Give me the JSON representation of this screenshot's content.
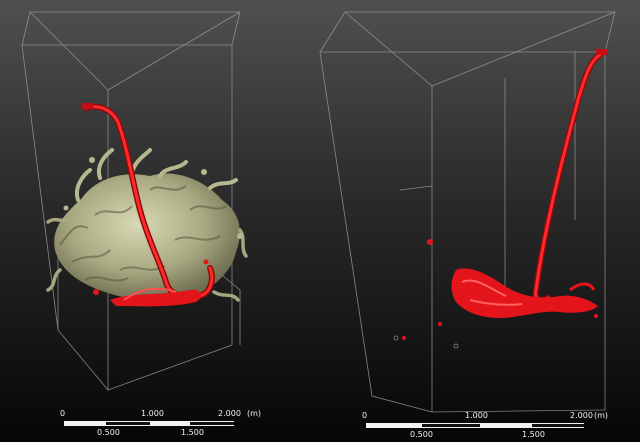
{
  "figure": {
    "left_panel": {
      "scale_labels_top": [
        "0",
        "1.000",
        "2.000",
        "(m)"
      ],
      "scale_labels_bottom": [
        "0.500",
        "1.500"
      ]
    },
    "right_panel": {
      "scale_labels_top": [
        "0",
        "1.000",
        "2.000",
        "(m)"
      ],
      "scale_labels_bottom": [
        "0.500",
        "1.500"
      ]
    },
    "colors": {
      "red_plume": "#e3151a",
      "dark_red": "#8e0a0c",
      "beige_vortices": "#b4b48c",
      "wireframe": "#9a9a9a"
    }
  }
}
